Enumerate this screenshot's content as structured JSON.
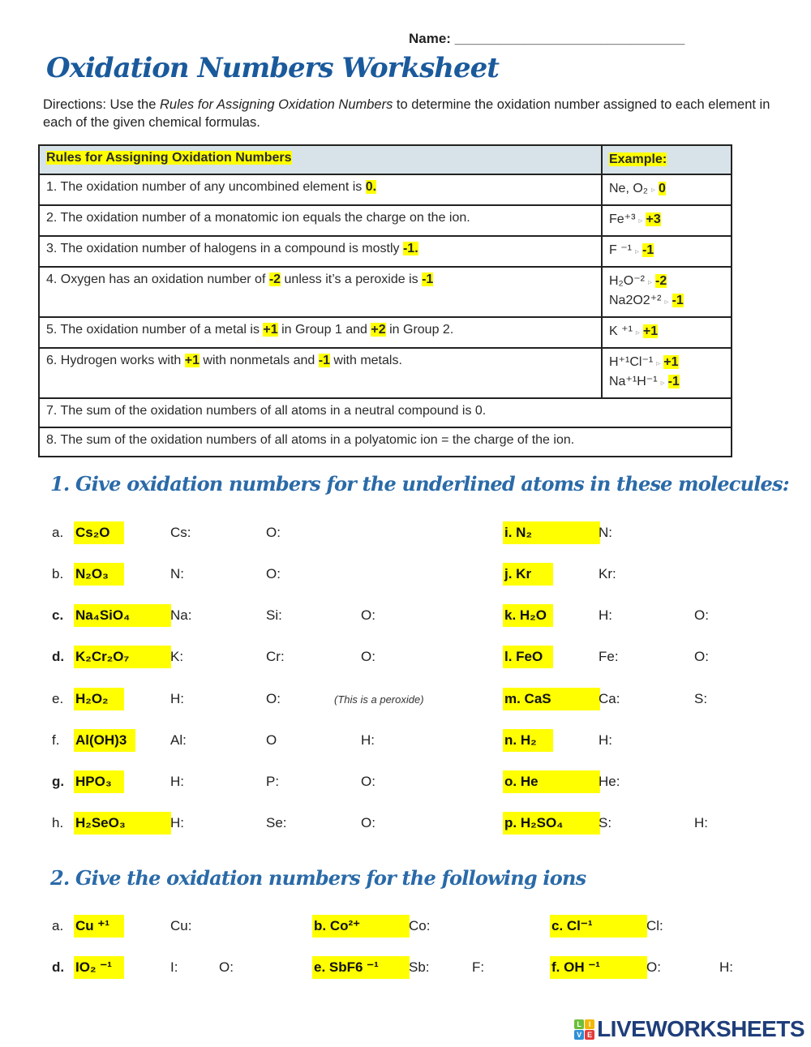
{
  "header": {
    "name_label": "Name: ",
    "name_blank": "______________________________",
    "title": "Oxidation Numbers Worksheet",
    "directions_prefix": "Directions: Use the ",
    "directions_italic": "Rules for Assigning Oxidation Numbers",
    "directions_suffix": " to determine the oxidation number assigned to each element in each of the given chemical formulas."
  },
  "rules_table": {
    "col_rules": "Rules for Assigning Oxidation Numbers",
    "col_example": "Example:",
    "rows": [
      {
        "pre": "1. The oxidation number of any uncombined element is ",
        "hl1": "0.",
        "mid": "",
        "hl2": "",
        "post": "",
        "example": [
          {
            "formula": "Ne, O₂",
            "value": "0"
          }
        ]
      },
      {
        "pre": "2. The oxidation number of a monatomic ion equals the charge on the ion.",
        "hl1": "",
        "mid": "",
        "hl2": "",
        "post": "",
        "example": [
          {
            "formula": "Fe⁺³",
            "value": "+3"
          }
        ]
      },
      {
        "pre": "3. The oxidation number of halogens in a compound is mostly ",
        "hl1": "-1.",
        "mid": "",
        "hl2": "",
        "post": "",
        "example": [
          {
            "formula": "F ⁻¹",
            "value": "-1"
          }
        ]
      },
      {
        "pre": "4. Oxygen has an oxidation number of ",
        "hl1": "-2",
        "mid": " unless it’s a peroxide is ",
        "hl2": "-1",
        "post": "",
        "example": [
          {
            "formula": "H₂O⁻²",
            "value": "-2"
          },
          {
            "formula": "Na2O2⁺²",
            "value": "-1"
          }
        ]
      },
      {
        "pre": "5.  The oxidation number of a metal is ",
        "hl1": "+1",
        "mid": " in Group 1 and ",
        "hl2": "+2",
        "post": " in Group 2.",
        "example": [
          {
            "formula": "K ⁺¹",
            "value": "+1"
          }
        ]
      },
      {
        "pre": "6. Hydrogen works with ",
        "hl1": "+1",
        "mid": " with nonmetals and ",
        "hl2": "-1",
        "post": " with metals.",
        "example": [
          {
            "formula": "H⁺¹Cl⁻¹",
            "value": "+1"
          },
          {
            "formula": "Na⁺¹H⁻¹",
            "value": "-1"
          }
        ]
      },
      {
        "pre": "7.  The sum of the oxidation numbers of all atoms in a neutral compound is 0.",
        "hl1": "",
        "mid": "",
        "hl2": "",
        "post": "",
        "example": []
      },
      {
        "pre": "8. The sum of the oxidation numbers of all atoms in a polyatomic ion = the charge of the ion.",
        "hl1": "",
        "mid": "",
        "hl2": "",
        "post": "",
        "example": []
      }
    ],
    "arrow_icon": "▹"
  },
  "section1": {
    "title": "1.  Give oxidation numbers for the underlined atoms in these molecules:",
    "left": [
      {
        "label": "a.",
        "formula": "Cs₂O",
        "fields": [
          "Cs:",
          "O:"
        ],
        "note": ""
      },
      {
        "label": "b.",
        "formula": "N₂O₃",
        "fields": [
          "N:",
          "O:"
        ],
        "note": ""
      },
      {
        "label": "c.",
        "formula": "Na₄SiO₄",
        "fields": [
          "Na:",
          "Si:",
          "O:"
        ],
        "note": ""
      },
      {
        "label": "d.",
        "formula": "K₂Cr₂O₇",
        "fields": [
          "K:",
          "Cr:",
          "O:"
        ],
        "note": ""
      },
      {
        "label": "e.",
        "formula": "H₂O₂",
        "fields": [
          "H:",
          "O:"
        ],
        "note": "(This is a peroxide)"
      },
      {
        "label": "f.",
        "formula": "Al(OH)3",
        "fields": [
          "Al:",
          "O",
          "H:"
        ],
        "note": ""
      },
      {
        "label": "g.",
        "formula": "HPO₃",
        "fields": [
          "H:",
          "P:",
          "O:"
        ],
        "note": ""
      },
      {
        "label": "h.",
        "formula": "H₂SeO₃",
        "fields": [
          "H:",
          "Se:",
          "O:"
        ],
        "note": ""
      }
    ],
    "right": [
      {
        "formula": "i. N₂",
        "fields": [
          "N:"
        ]
      },
      {
        "formula": "j. Kr",
        "fields": [
          "Kr:"
        ]
      },
      {
        "formula": "k. H₂O",
        "fields": [
          "H:",
          "O:"
        ]
      },
      {
        "formula": "l. FeO",
        "fields": [
          "Fe:",
          "O:"
        ]
      },
      {
        "formula": "m. CaS",
        "fields": [
          "Ca:",
          "S:"
        ]
      },
      {
        "formula": "n. H₂",
        "fields": [
          "H:"
        ]
      },
      {
        "formula": "o. He",
        "fields": [
          "He:"
        ]
      },
      {
        "formula": "p. H₂SO₄",
        "fields": [
          "S:",
          "H:"
        ]
      }
    ]
  },
  "section2": {
    "title": "2. Give the oxidation numbers for the following ions",
    "items": [
      {
        "label": "a.",
        "formula": "Cu ⁺¹",
        "fields": [
          "Cu:"
        ]
      },
      {
        "label": "",
        "formula": "b. Co²⁺",
        "fields": [
          "Co:"
        ]
      },
      {
        "label": "",
        "formula": "c.   Cl⁻¹",
        "fields": [
          "Cl:"
        ]
      },
      {
        "label": "d.",
        "formula": "IO₂  ⁻¹",
        "fields": [
          "I:",
          "O:"
        ]
      },
      {
        "label": "",
        "formula": "e. SbF6  ⁻¹",
        "fields": [
          "Sb:",
          "F:"
        ]
      },
      {
        "label": "",
        "formula": "f.  OH  ⁻¹",
        "fields": [
          "O:",
          "H:"
        ]
      }
    ]
  },
  "footer": {
    "logo_text": "LIVEWORKSHEETS",
    "logo_letters": [
      "L",
      "I",
      "V",
      "E"
    ],
    "logo_colors": [
      "#6cbf3a",
      "#f2b705",
      "#2e8fd6",
      "#e23b3b"
    ]
  },
  "colors": {
    "title_blue": "#1a5a9c",
    "section_blue": "#2a6aa8",
    "highlight": "#ffff00",
    "table_header_bg": "#d7e3e8"
  }
}
